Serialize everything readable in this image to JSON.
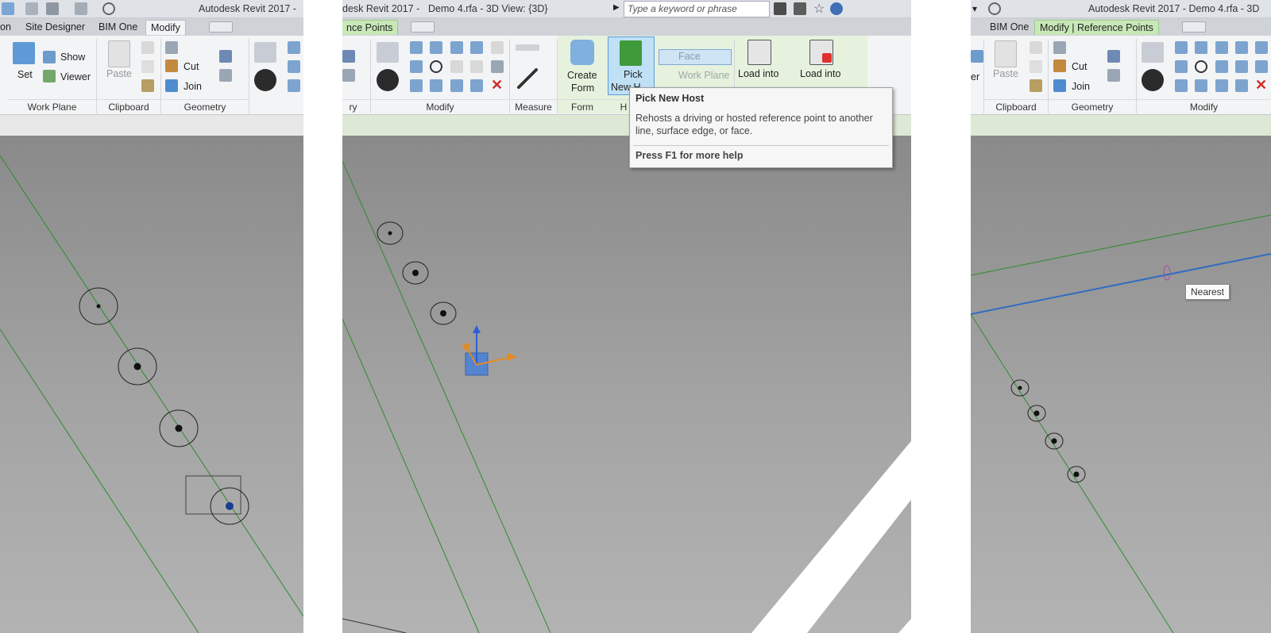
{
  "left": {
    "title": "Autodesk Revit 2017 -",
    "tabs": [
      "on",
      "Site Designer",
      "BIM One",
      "Modify"
    ],
    "buttons": {
      "set": "Set",
      "show": "Show",
      "viewer": "Viewer",
      "paste": "Paste",
      "cut": "Cut",
      "join": "Join"
    },
    "groups": [
      "Work Plane",
      "Clipboard",
      "Geometry"
    ]
  },
  "middle": {
    "title_app": "desk Revit 2017 -",
    "title_doc": "Demo 4.rfa - 3D View: {3D}",
    "search_placeholder": "Type a keyword or phrase",
    "context_tab": "nce Points",
    "buttons": {
      "create_form": "Create",
      "create_form_2": "Form",
      "pick_new_host": "Pick",
      "pick_new_host_2": "New H",
      "face": "Face",
      "work_plane": "Work Plane",
      "load_project": "Load into",
      "load_project_close": "Load into"
    },
    "groups": [
      "ry",
      "Modify",
      "Measure",
      "Form",
      "H"
    ],
    "tooltip": {
      "title": "Pick New Host",
      "body": "Rehosts a driving or hosted reference point to another line, surface edge, or face.",
      "help": "Press F1 for more help"
    }
  },
  "right": {
    "title": "Autodesk Revit 2017 -   Demo 4.rfa - 3D",
    "tabs": [
      "BIM One",
      "Modify | Reference Points"
    ],
    "buttons": {
      "paste": "Paste",
      "cut": "Cut",
      "join": "Join",
      "er": "er"
    },
    "groups": [
      "Clipboard",
      "Geometry",
      "Modify"
    ],
    "snap_label": "Nearest"
  },
  "colors": {
    "ribbon": "#f3f4f6",
    "context_tab": "#c9e8b8",
    "ref_line": "#2e8b2e",
    "selected_line": "#2f6dc0",
    "viewport": "#9d9d9d"
  }
}
